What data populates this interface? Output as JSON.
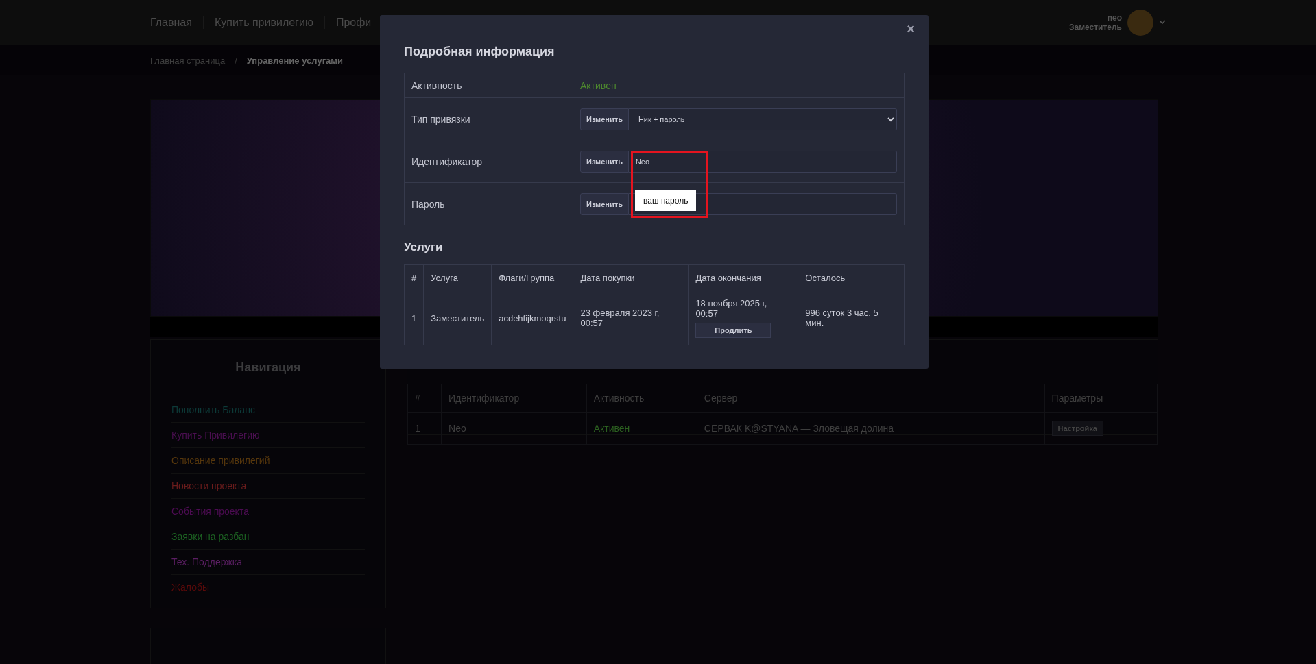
{
  "topnav": {
    "items": [
      {
        "label": "Главная"
      },
      {
        "label": "Купить привилегию"
      },
      {
        "label": "Профи"
      }
    ],
    "user": {
      "name": "neo",
      "role": "Заместитель"
    }
  },
  "breadcrumb": {
    "separator": "/",
    "items": [
      {
        "label": "Главная страница",
        "selected": false
      },
      {
        "label": "Управление услугами",
        "selected": true
      }
    ]
  },
  "sidebar": {
    "title": "Навигация",
    "items": [
      {
        "label": "Пополнить Баланс",
        "color": "#0d3a38"
      },
      {
        "label": "Купить Привилегию",
        "color": "#4a0f50"
      },
      {
        "label": "Описание привилегий",
        "color": "#55360c"
      },
      {
        "label": "Новости проекта",
        "color": "#6a1c1c"
      },
      {
        "label": "События проекта",
        "color": "#4c0c52"
      },
      {
        "label": "Заявки на разбан",
        "color": "#1c6222"
      },
      {
        "label": "Тех. Поддержка",
        "color": "#5a1e62"
      },
      {
        "label": "Жалобы",
        "color": "#5a0a0a"
      }
    ]
  },
  "services_table": {
    "columns": [
      "#",
      "Идентификатор",
      "Активность",
      "Сервер",
      "Параметры"
    ],
    "rows": [
      {
        "cells": [
          "1",
          "Neo",
          "Активен",
          "СЕРВАК K@STYANA — Зловещая долина"
        ],
        "button": "Настройка"
      }
    ]
  },
  "modal": {
    "title": "Подробная информация",
    "close": "×",
    "details": [
      {
        "kind": "status",
        "label": "Активность",
        "value": "Активен"
      },
      {
        "kind": "select",
        "label": "Тип привязки",
        "button": "Изменить",
        "value": "Ник + пароль"
      },
      {
        "kind": "input",
        "label": "Идентификатор",
        "button": "Изменить",
        "value": "Neo"
      },
      {
        "kind": "input",
        "label": "Пароль",
        "button": "Изменить"
      }
    ],
    "annotation": {
      "label": "ваш пароль"
    },
    "services_title": "Услуги",
    "services": {
      "columns": [
        "#",
        "Услуга",
        "Флаги/Группа",
        "Дата покупки",
        "Дата окончания",
        "Осталось"
      ],
      "rows": [
        {
          "cells": [
            "1",
            "Заместитель",
            "acdehfijkmoqrstu",
            "23 февраля 2023 г, 00:57",
            "18 ноября 2025 г, 00:57"
          ],
          "button": "Продлить",
          "remaining": "996 суток 3 час. 5 мин."
        }
      ]
    }
  }
}
